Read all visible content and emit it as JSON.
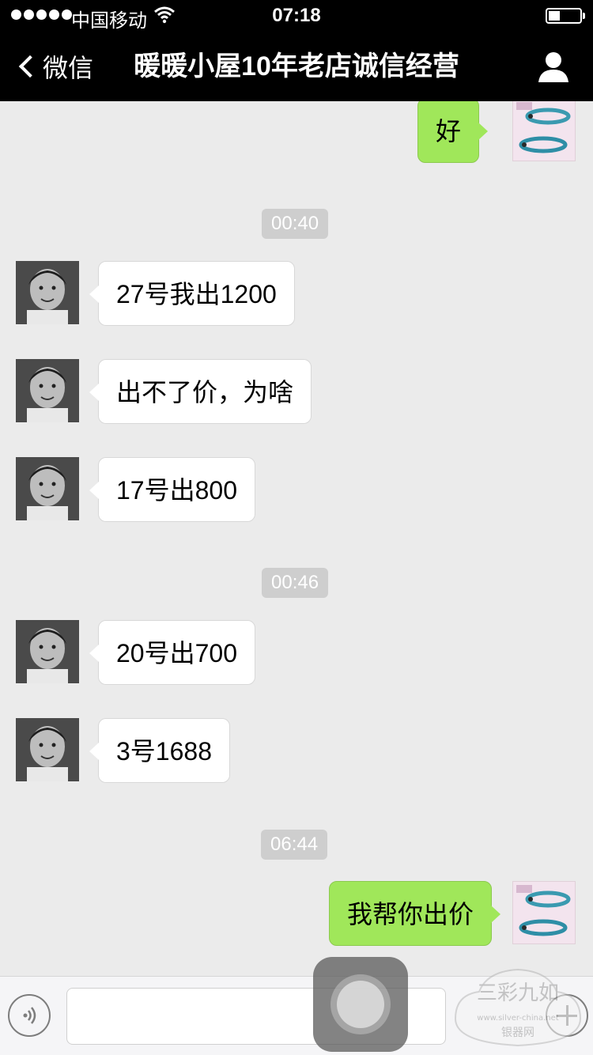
{
  "status_bar": {
    "carrier": "中国移动",
    "time": "07:18",
    "battery_level": 0.3
  },
  "nav": {
    "back_label": "微信",
    "title": "暖暖小屋10年老店诚信经营",
    "profile_icon": "person-icon"
  },
  "messages": [
    {
      "side": "out",
      "text": "好"
    },
    {
      "type": "time",
      "text": "00:40"
    },
    {
      "side": "in",
      "text": "27号我出1200"
    },
    {
      "side": "in",
      "text": "出不了价，为啥"
    },
    {
      "side": "in",
      "text": "17号出800"
    },
    {
      "type": "time",
      "text": "00:46"
    },
    {
      "side": "in",
      "text": "20号出700"
    },
    {
      "side": "in",
      "text": "3号1688"
    },
    {
      "type": "time",
      "text": "06:44"
    },
    {
      "side": "out",
      "text": "我帮你出价"
    }
  ],
  "input_bar": {
    "voice_icon": "voice-icon",
    "input_value": "",
    "plus_icon": "plus-icon"
  },
  "watermark": {
    "text_top": "三彩九如",
    "text_url": "www.silver-china.net",
    "text_bottom": "银器网"
  },
  "colors": {
    "nav_bg": "#000000",
    "chat_bg": "#ebebeb",
    "out_bubble": "#a0e75a",
    "in_bubble": "#ffffff",
    "timestamp_bg": "#cecece"
  }
}
